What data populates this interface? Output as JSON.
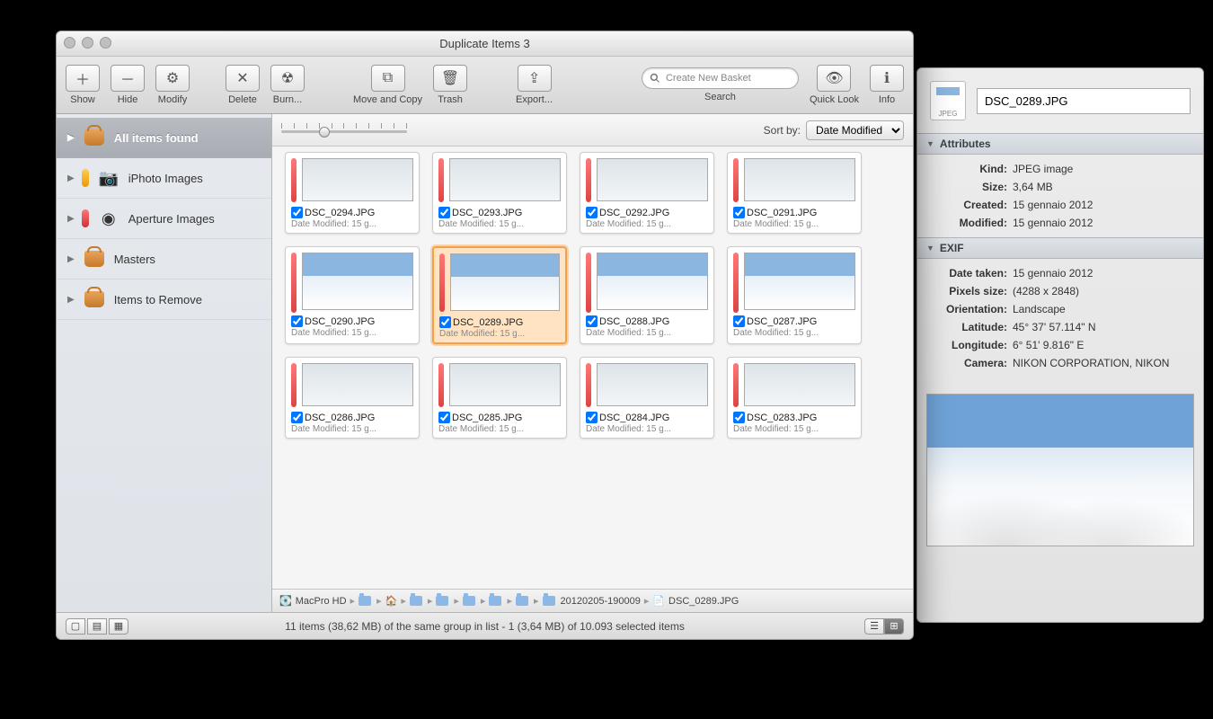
{
  "window": {
    "title": "Duplicate Items 3"
  },
  "toolbar": {
    "show": "Show",
    "hide": "Hide",
    "modify": "Modify",
    "delete": "Delete",
    "burn": "Burn...",
    "movecopy": "Move and Copy",
    "trash": "Trash",
    "export": "Export...",
    "search": "Search",
    "quicklook": "Quick Look",
    "info": "Info",
    "search_placeholder": "Create New Basket"
  },
  "sidebar": {
    "items": [
      {
        "label": "All items found"
      },
      {
        "label": "iPhoto Images"
      },
      {
        "label": "Aperture Images"
      },
      {
        "label": "Masters"
      },
      {
        "label": "Items to Remove"
      }
    ]
  },
  "browser": {
    "sort_label": "Sort by:",
    "sort_value": "Date Modified",
    "meta_text": "Date Modified: 15 g...",
    "files_row1": [
      "DSC_0294.JPG",
      "DSC_0293.JPG",
      "DSC_0292.JPG",
      "DSC_0291.JPG"
    ],
    "files_row2": [
      "DSC_0290.JPG",
      "DSC_0289.JPG",
      "DSC_0288.JPG",
      "DSC_0287.JPG"
    ],
    "files_row3": [
      "DSC_0286.JPG",
      "DSC_0285.JPG",
      "DSC_0284.JPG",
      "DSC_0283.JPG"
    ]
  },
  "path": {
    "disk": "MacPro HD",
    "folder": "20120205-190009",
    "file": "DSC_0289.JPG"
  },
  "status": "11 items (38,62 MB) of the same group in list - 1 (3,64 MB) of 10.093 selected items",
  "info": {
    "filetype_label": "JPEG",
    "filename": "DSC_0289.JPG",
    "section_attr": "Attributes",
    "section_exif": "EXIF",
    "attr": {
      "kind_k": "Kind:",
      "kind_v": "JPEG image",
      "size_k": "Size:",
      "size_v": "3,64 MB",
      "created_k": "Created:",
      "created_v": "15 gennaio 2012",
      "modified_k": "Modified:",
      "modified_v": "15 gennaio 2012"
    },
    "exif": {
      "date_k": "Date taken:",
      "date_v": "15 gennaio 2012",
      "px_k": "Pixels size:",
      "px_v": "(4288 x 2848)",
      "orient_k": "Orientation:",
      "orient_v": "Landscape",
      "lat_k": "Latitude:",
      "lat_v": "45° 37' 57.114\" N",
      "lon_k": "Longitude:",
      "lon_v": "6° 51' 9.816\" E",
      "cam_k": "Camera:",
      "cam_v": "NIKON CORPORATION, NIKON"
    }
  }
}
